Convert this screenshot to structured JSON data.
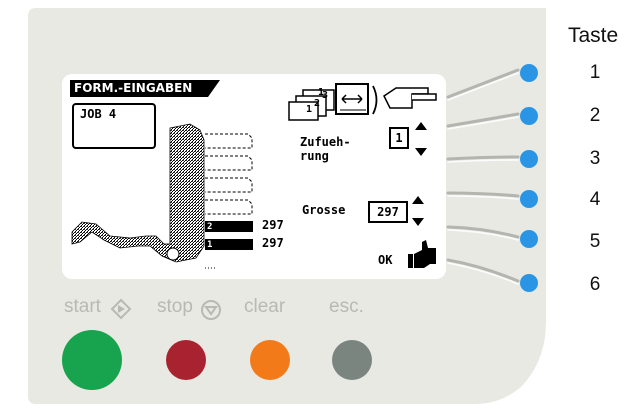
{
  "lcd": {
    "title": "FORM.-EINGABEN",
    "job": "JOB  4",
    "zufuehrung_line1": "Zufueh-",
    "zufuehrung_line2": "rung",
    "zufuehrung_value": "1",
    "grosse_label": "Grosse",
    "grosse_value": "297",
    "stack2_value": "297",
    "stack1_value": "297",
    "stack2_num": "2",
    "stack1_num": "1",
    "ok_label": "OK",
    "page_icon_digits": [
      "1",
      "2",
      "3"
    ]
  },
  "taste": {
    "header": "Taste",
    "numbers": [
      "1",
      "2",
      "3",
      "4",
      "5",
      "6"
    ]
  },
  "controls": {
    "start_label": "start",
    "stop_label": "stop",
    "clear_label": "clear",
    "esc_label": "esc."
  },
  "colors": {
    "panel": "#e9e9e4",
    "softkey": "#2a95e4",
    "start": "#18a44e",
    "stop": "#a8232f",
    "clear": "#f27a18",
    "esc": "#7b857f"
  }
}
